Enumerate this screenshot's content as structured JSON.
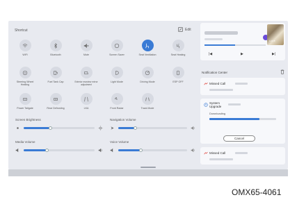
{
  "shortcut": {
    "title": "Shortcut",
    "edit_label": "Edit",
    "tiles": [
      {
        "label": "WiFi",
        "icon": "wifi-icon",
        "active": false
      },
      {
        "label": "Bluetooth",
        "icon": "bluetooth-icon",
        "active": false
      },
      {
        "label": "Mute",
        "icon": "mute-icon",
        "active": false
      },
      {
        "label": "Screen Saver",
        "icon": "screen-saver-icon",
        "active": false
      },
      {
        "label": "Seat Ventilation",
        "icon": "seat-ventilation-icon",
        "active": true
      },
      {
        "label": "Seat Heating",
        "icon": "seat-heating-icon",
        "active": false
      },
      {
        "label": "Steering Wheel Heating",
        "icon": "steering-wheel-icon",
        "active": false
      },
      {
        "label": "Fuel Tank Cap",
        "icon": "fuel-cap-icon",
        "active": false
      },
      {
        "label": "Exterior rearview mirror adjustment",
        "icon": "mirror-icon",
        "active": false
      },
      {
        "label": "Light Mode",
        "icon": "light-mode-icon",
        "active": false
      },
      {
        "label": "Driving Mode",
        "icon": "driving-mode-icon",
        "active": false
      },
      {
        "label": "ESP OFF",
        "icon": "esp-icon",
        "active": false
      },
      {
        "label": "Power Tailgate",
        "icon": "tailgate-icon",
        "active": false
      },
      {
        "label": "Rear Defrosting",
        "icon": "defrost-icon",
        "active": false
      },
      {
        "label": "LKA",
        "icon": "lka-icon",
        "active": false
      },
      {
        "label": "Front Radar",
        "icon": "radar-icon",
        "active": false
      },
      {
        "label": "Track Mode",
        "icon": "track-mode-icon",
        "active": false
      }
    ]
  },
  "sliders": {
    "screen_brightness": {
      "label": "Screen Brightness",
      "value": 0.38
    },
    "navigation_volume": {
      "label": "Navigation Volume",
      "value": 0.25
    },
    "media_volume": {
      "label": "Media Volume",
      "value": 0.33
    },
    "voice_volume": {
      "label": "Voice Volume",
      "value": 0.33
    }
  },
  "music": {
    "prev_icon": "previous-track-icon",
    "play_icon": "play-icon",
    "next_icon": "next-track-icon",
    "progress": 0.5
  },
  "notifications": {
    "title": "Notification Center",
    "items": [
      {
        "title": "Missed Call"
      },
      {
        "title": "System Upgrade",
        "status": "Downloading",
        "progress": 0.75,
        "button": "Cancel"
      },
      {
        "title": "Missed Call"
      }
    ]
  },
  "image_code": "OMX65-4061",
  "colors": {
    "accent": "#3a7bd5",
    "missed_call": "#e0443c",
    "background": "#e8eaf0"
  }
}
